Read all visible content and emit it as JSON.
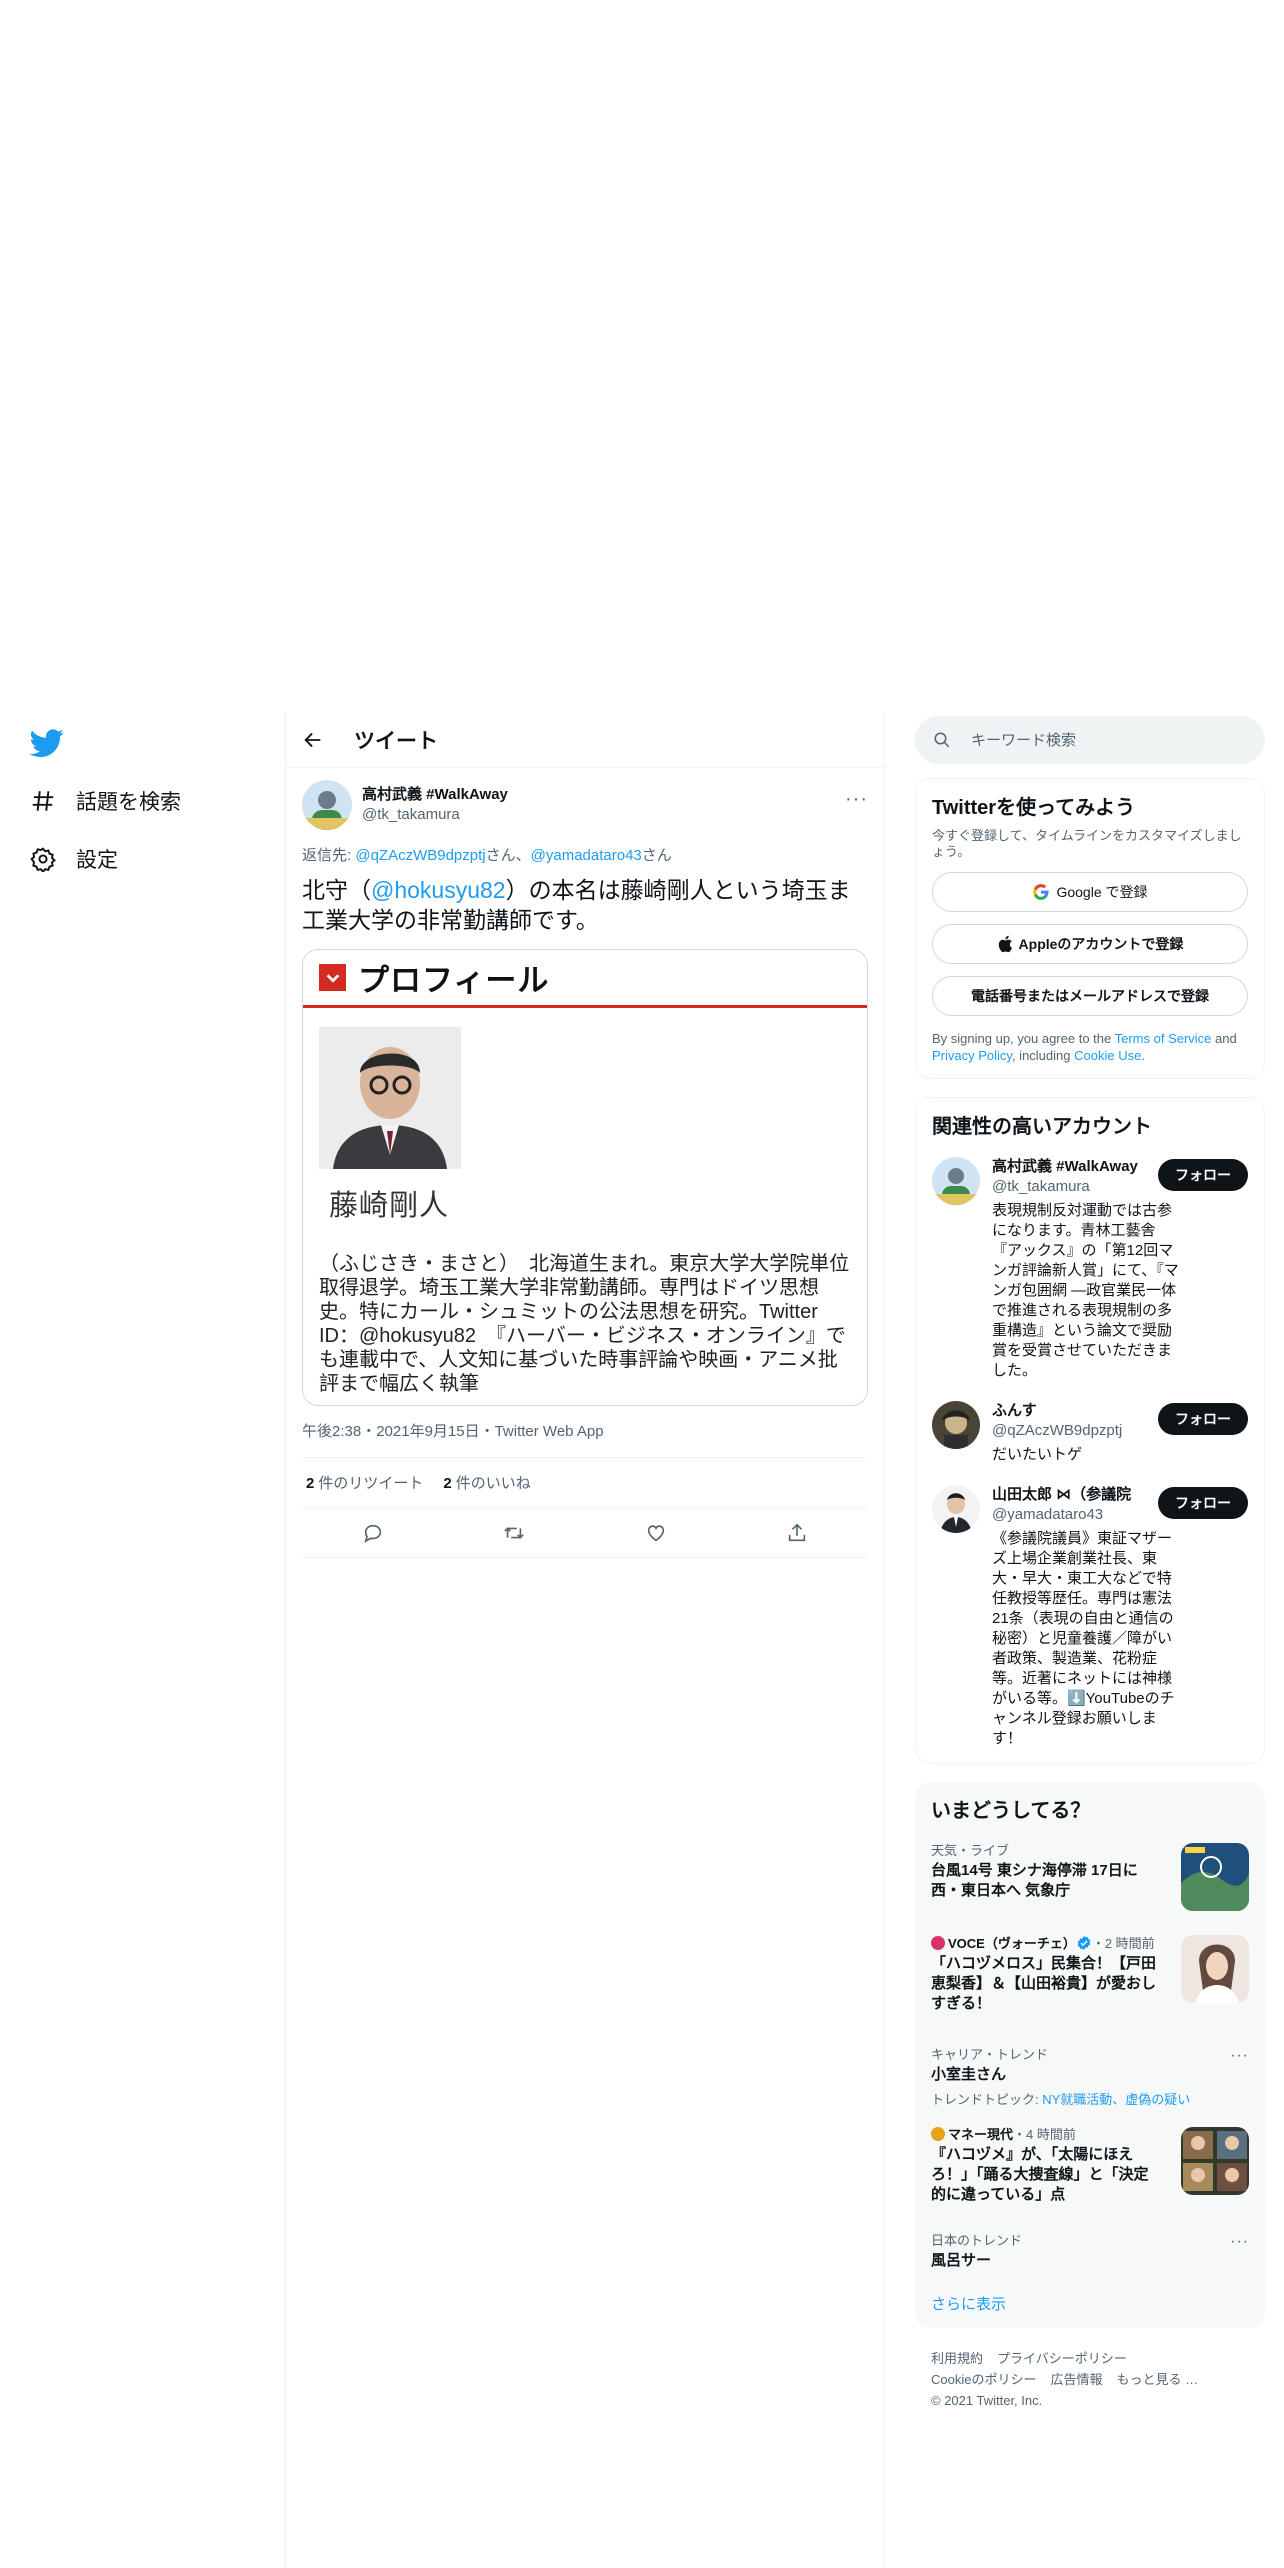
{
  "nav": {
    "explore": "話題を検索",
    "settings": "設定"
  },
  "header": {
    "title": "ツイート"
  },
  "tweet": {
    "author_name": "高村武義 #WalkAway",
    "author_handle": "@tk_takamura",
    "reply_prefix": "返信先: ",
    "reply_handle_1": "@qZAczWB9dpzptj",
    "reply_suffix_1": "さん、",
    "reply_handle_2": "@yamadataro43",
    "reply_suffix_2": "さん",
    "text_before": "北守（",
    "text_mention": "@hokusyu82",
    "text_after": "）の本名は藤崎剛人という埼玉ま工業大学の非常勤講師です。",
    "media": {
      "heading": "プロフィール",
      "name": "藤崎剛人",
      "body": "（ふじさき・まさと）　北海道生まれ。東京大学大学院単位取得退学。埼玉工業大学非常勤講師。専門はドイツ思想史。特にカール・シュミットの公法思想を研究。Twitter ID：@hokusyu82　『ハーバー・ビジネス・オンライン』でも連載中で、人文知に基づいた時事評論や映画・アニメ批評まで幅広く執筆"
    },
    "meta": "午後2:38・2021年9月15日・Twitter Web App",
    "retweets_count": "2",
    "retweets_label": "件のリツイート",
    "likes_count": "2",
    "likes_label": "件のいいね"
  },
  "search": {
    "placeholder": "キーワード検索"
  },
  "signup": {
    "title": "Twitterを使ってみよう",
    "sub": "今すぐ登録して、タイムラインをカスタマイズしましょう。",
    "google": "Google で登録",
    "apple": "Appleのアカウントで登録",
    "phone": "電話番号またはメールアドレスで登録",
    "legal_1": "By signing up, you agree to the ",
    "terms": "Terms of Service",
    "legal_2": " and ",
    "privacy": "Privacy Policy",
    "legal_3": ", including ",
    "cookie": "Cookie Use",
    "legal_4": "."
  },
  "who": {
    "title": "関連性の高いアカウント",
    "follow_label": "フォロー",
    "accounts": [
      {
        "name": "高村武義 #WalkAway",
        "handle": "@tk_takamura",
        "bio": "表現規制反対運動では古参になります。青林工藝舎『アックス』の「第12回マンガ評論新人賞」にて、『マンガ包囲網 ―政官業民一体で推進される表現規制の多重構造』という論文で奨励賞を受賞させていただきました。"
      },
      {
        "name": "ふんす",
        "handle": "@qZAczWB9dpzptj",
        "bio": "だいたいトゲ"
      },
      {
        "name": "山田太郎 ⋈（参議院",
        "handle": "@yamadataro43",
        "bio": "《参議院議員》東証マザーズ上場企業創業社長、東大・早大・東工大などで特任教授等歴任。専門は憲法21条（表現の自由と通信の秘密）と児童養護／障がい者政策、製造業、花粉症等。近著にネットには神様がいる等。⬇️YouTubeのチャンネル登録お願いします！"
      }
    ]
  },
  "trends": {
    "title": "いまどうしてる？",
    "items": [
      {
        "context": "天気・ライブ",
        "headline": "台風14号 東シナ海停滞 17日に西・東日本へ 気象庁"
      },
      {
        "source": "VOCE（ヴォーチェ）",
        "time": "・2 時間前",
        "headline": "「ハコヅメロス」民集合！【戸田恵梨香】＆【山田裕貴】が愛おしすぎる！"
      },
      {
        "context": "キャリア・トレンド",
        "headline": "小室圭さん",
        "topic_prefix": "トレンドトピック: ",
        "topic": "NY就職活動、虚偽の疑い"
      },
      {
        "source": "マネー現代",
        "time": "・4 時間前",
        "headline": "『ハコヅメ』が、「太陽にほえろ！」「踊る大捜査線」と「決定的に違っている」点"
      },
      {
        "context": "日本のトレンド",
        "headline": "風呂サー"
      }
    ],
    "show_more": "さらに表示"
  },
  "footer": {
    "terms": "利用規約",
    "privacy": "プライバシーポリシー",
    "cookie": "Cookieのポリシー",
    "ads": "広告情報",
    "more": "もっと見る …",
    "copyright": "© 2021 Twitter, Inc."
  },
  "colors": {
    "accent": "#1d9bf0",
    "text": "#0f1419",
    "muted": "#536471",
    "border": "#eff3f4",
    "profile_red": "#d42a1f"
  },
  "icons": [
    "twitter-logo-icon",
    "hashtag-icon",
    "gear-icon",
    "back-arrow-icon",
    "more-icon",
    "reply-icon",
    "retweet-icon",
    "like-icon",
    "share-icon",
    "search-icon",
    "google-icon",
    "apple-icon",
    "verified-icon"
  ]
}
